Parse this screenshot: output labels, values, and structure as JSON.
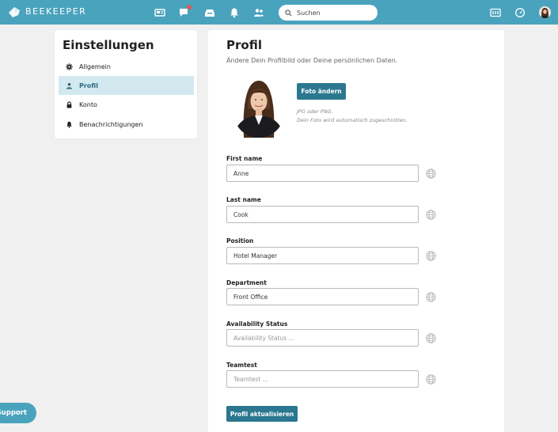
{
  "app": {
    "brand": "BEEKEEPER",
    "brand_color": "#4aa3bd",
    "accent": "#2b7790"
  },
  "topbar": {
    "nav_icons": [
      "news-icon",
      "chat-icon",
      "inbox-icon",
      "bell-icon",
      "people-icon"
    ],
    "search": {
      "placeholder": "Suchen"
    },
    "right_icons": [
      "apps-icon",
      "speedometer-icon",
      "user-avatar"
    ]
  },
  "sidebar": {
    "title": "Einstellungen",
    "items": [
      {
        "label": "Allgemein",
        "icon": "gear-icon",
        "active": false
      },
      {
        "label": "Profil",
        "icon": "person-icon",
        "active": true
      },
      {
        "label": "Konto",
        "icon": "lock-icon",
        "active": false
      },
      {
        "label": "Benachrichtigungen",
        "icon": "bell-icon",
        "active": false
      }
    ]
  },
  "profile": {
    "title": "Profil",
    "subtitle": "Ändere Dein Profilbild oder Deine persönlichen Daten.",
    "change_photo_label": "Foto ändern",
    "photo_hint_1": "JPG oder PNG.",
    "photo_hint_2": "Dein Foto wird automatisch zugeschnitten.",
    "fields": [
      {
        "label": "First name",
        "value": "Anne",
        "placeholder": ""
      },
      {
        "label": "Last name",
        "value": "Cook",
        "placeholder": ""
      },
      {
        "label": "Position",
        "value": "Hotel Manager",
        "placeholder": ""
      },
      {
        "label": "Department",
        "value": "Front Office",
        "placeholder": ""
      },
      {
        "label": "Availability Status",
        "value": "",
        "placeholder": "Availability Status ..."
      },
      {
        "label": "Teamtest",
        "value": "",
        "placeholder": "Teamtest ..."
      }
    ],
    "submit_label": "Profil aktualisieren"
  },
  "support": {
    "label": "Support"
  }
}
